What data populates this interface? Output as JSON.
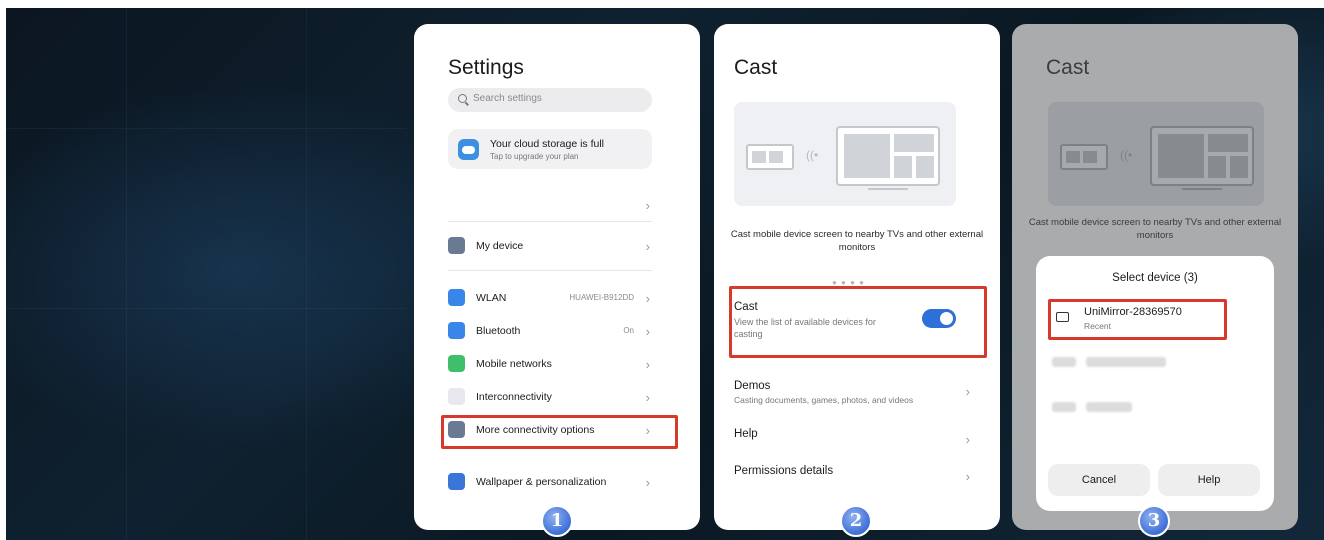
{
  "settings": {
    "title": "Settings",
    "search_placeholder": "Search settings",
    "cloud_title": "Your cloud storage is full",
    "cloud_subtitle": "Tap to upgrade your plan",
    "items": [
      {
        "label": "My device",
        "value": "",
        "icon": "phone-icon",
        "color": "#6b7a93"
      },
      {
        "label": "WLAN",
        "value": "HUAWEI-B912DD",
        "icon": "wifi-icon",
        "color": "#3a86e8"
      },
      {
        "label": "Bluetooth",
        "value": "On",
        "icon": "bluetooth-icon",
        "color": "#3a86e8"
      },
      {
        "label": "Mobile networks",
        "value": "",
        "icon": "signal-icon",
        "color": "#3fbf6a"
      },
      {
        "label": "Interconnectivity",
        "value": "",
        "icon": "interconnect-icon",
        "color": "#e8e8ee"
      },
      {
        "label": "More connectivity options",
        "value": "",
        "icon": "link-icon",
        "color": "#6b7a93"
      },
      {
        "label": "Wallpaper & personalization",
        "value": "",
        "icon": "brush-icon",
        "color": "#3a76d8"
      }
    ]
  },
  "cast": {
    "title": "Cast",
    "caption": "Cast mobile device screen to nearby TVs and other external monitors",
    "toggle_title": "Cast",
    "toggle_desc": "View the list of available devices for casting",
    "toggle_on": true,
    "demos_title": "Demos",
    "demos_desc": "Casting documents, games, photos, and videos",
    "help": "Help",
    "permissions": "Permissions details"
  },
  "select": {
    "title": "Cast",
    "caption": "Cast mobile device screen to nearby TVs and other external monitors",
    "sheet_title": "Select device (3)",
    "device_name": "UniMirror-28369570",
    "device_sub": "Recent",
    "cancel": "Cancel",
    "help": "Help"
  },
  "steps": [
    "1",
    "2",
    "3"
  ],
  "highlight_color": "#d7392b"
}
